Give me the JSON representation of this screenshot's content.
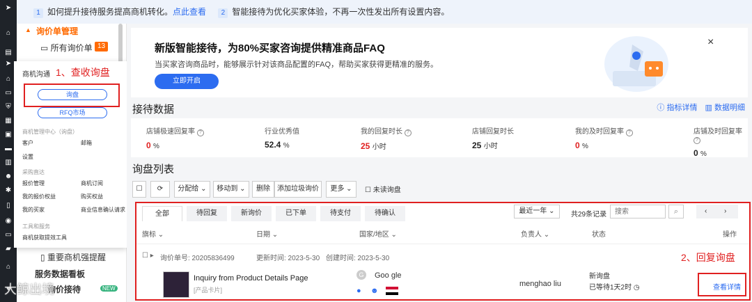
{
  "banner": {
    "tip1_num": "1",
    "tip1_text": "如何提升接待服务提高商机转化。",
    "tip1_link": "点此查看",
    "tip2_num": "2",
    "tip2_text": "智能接待为优化买家体验，不再一次性发出所有设置内容。"
  },
  "subnav": {
    "header": "询价单管理",
    "all_label": "所有询价单",
    "all_count": "13",
    "bottom1": "重要商机强提醒",
    "bottom2": "服务数据看板",
    "bottom3": "询价接待",
    "new_badge": "NEW"
  },
  "popup": {
    "title": "商机沟通",
    "annotation": "1、查收询盘",
    "btn_inquiry": "询盘",
    "btn_rfq": "RFQ市场",
    "section1": "商机管理中心（询盘）",
    "customer": "客户",
    "mailbox": "邮箱",
    "settings": "设置",
    "section2": "采购直达",
    "quote_mgmt": "报价管理",
    "biz_sub": "商机订阅",
    "my_quote_rights": "我的报价权益",
    "buy_rights": "购买权益",
    "my_buyers": "我的买家",
    "biz_info": "商业信息确认请求",
    "section3": "工具和服务",
    "tool": "商机获取提效工具"
  },
  "promo": {
    "title": "新版智能接待，为80%买家咨询提供精准商品FAQ",
    "subtitle": "当买家咨询商品时，能够展示针对该商品配置的FAQ，帮助买家获得更精准的服务。",
    "button": "立即开启",
    "close": "×"
  },
  "reception": {
    "title": "接待数据",
    "link_detail": "指标详情",
    "link_data": "数据明细",
    "stats": [
      {
        "label": "店铺极速回复率",
        "value": "0",
        "unit": "%",
        "red": true,
        "help": true
      },
      {
        "label": "行业优秀值",
        "value": "52.4",
        "unit": "%",
        "red": false,
        "help": false
      },
      {
        "label": "我的回复时长",
        "value": "25",
        "unit": "小时",
        "red": true,
        "help": true
      },
      {
        "label": "店铺回复时长",
        "value": "25",
        "unit": "小时",
        "red": false,
        "help": false
      },
      {
        "label": "我的及时回复率",
        "value": "0",
        "unit": "%",
        "red": true,
        "help": true
      },
      {
        "label": "店铺及时回复率",
        "value": "0",
        "unit": "%",
        "red": false,
        "help": true
      }
    ]
  },
  "inquiry": {
    "title": "询盘列表",
    "toolbar": {
      "assign": "分配给 ⌄",
      "move": "移动到 ⌄",
      "delete": "删除",
      "spam": "添加垃圾询价",
      "more": "更多 ⌄",
      "unread": "未读询盘"
    },
    "tabs": [
      "全部",
      "待回复",
      "新询价",
      "已下单",
      "待支付",
      "待确认"
    ],
    "period": "最近一年 ⌄",
    "total": "共29条记录",
    "search_placeholder": "搜索",
    "columns": {
      "flag": "旗标 ⌄",
      "date": "日期 ⌄",
      "country": "国家/地区 ⌄",
      "owner": "负责人 ⌄",
      "status": "状态",
      "action": "操作"
    },
    "row": {
      "order_label": "询价单号: 20205836499",
      "updated": "更新时间: 2023-5-30",
      "created": "创建时间: 2023-5-30",
      "product_title": "Inquiry from Product Details Page",
      "product_tag": "[产品卡片]",
      "buyer": "Goo gle",
      "buyer_initial": "G",
      "owner": "menghao liu",
      "status": "新询盘",
      "wait": "已等待1天2时",
      "action": "查看详情"
    },
    "annotation": "2、回复询盘"
  },
  "watermark": "大鲸出境"
}
